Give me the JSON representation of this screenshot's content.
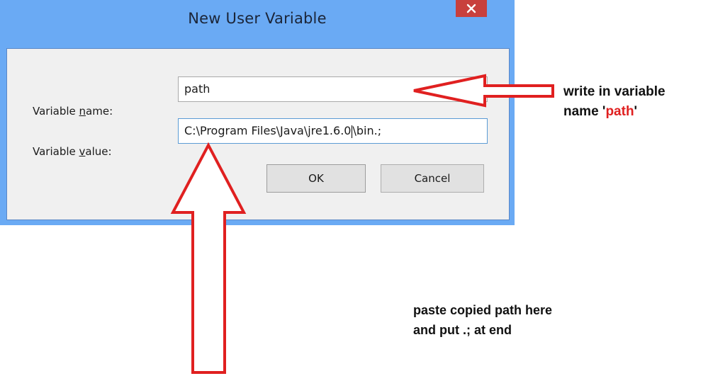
{
  "window": {
    "title": "New User Variable",
    "close_symbol": "✕"
  },
  "form": {
    "name_label_pre": "Variable ",
    "name_label_key": "n",
    "name_label_post": "ame:",
    "name_value": "path",
    "value_label_pre": "Variable ",
    "value_label_key": "v",
    "value_label_post": "alue:",
    "value_text_a": "C:\\Program Files\\Java\\jre1.6.0",
    "value_text_b": "\\bin.;"
  },
  "buttons": {
    "ok_label": "OK",
    "cancel_label": "Cancel"
  },
  "annotations": {
    "right_line1": "write in variable",
    "right_line2_pre": "name '",
    "right_line2_highlight": "path",
    "right_line2_post": "'",
    "bottom_line1": "paste copied path here",
    "bottom_line2": "and put .; at end"
  },
  "colors": {
    "titlebar": "#6aaaf4",
    "close_button": "#c8403d",
    "arrow": "#e02020"
  }
}
